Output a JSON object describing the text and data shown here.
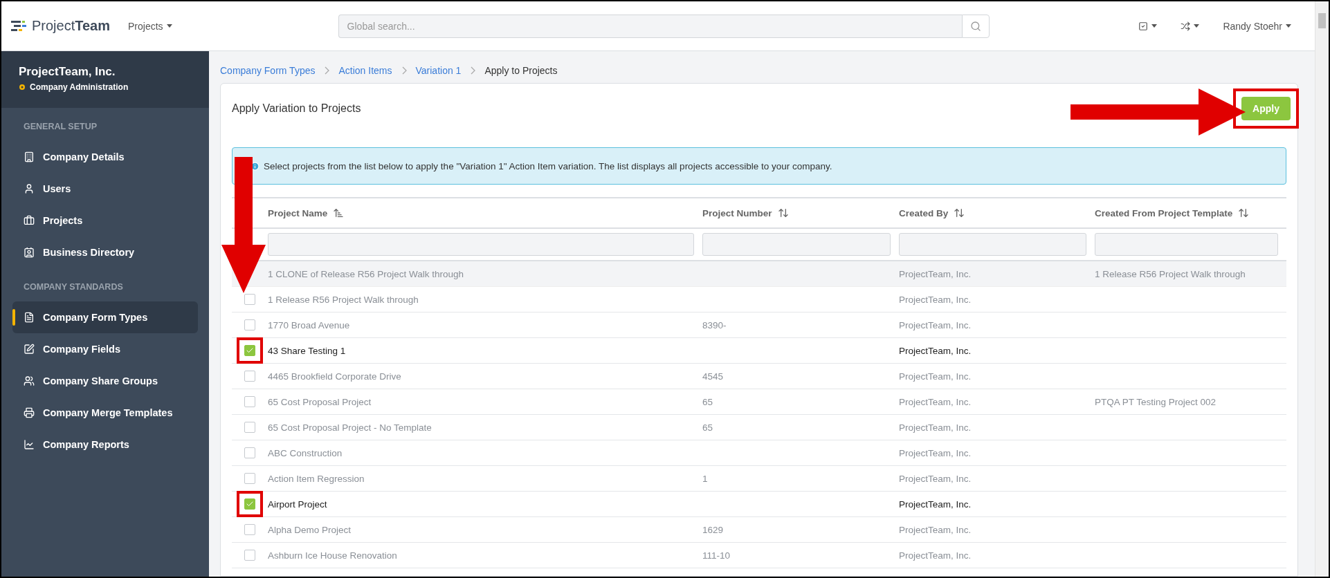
{
  "header": {
    "logo": "Project**Team**",
    "projects_menu": "Projects",
    "search": {
      "placeholder": "Global search..."
    },
    "user_menu": "Randy Stoehr"
  },
  "sidebar": {
    "company": "ProjectTeam, Inc.",
    "subtitle": "Company Administration",
    "sections": [
      {
        "heading": "GENERAL SETUP",
        "items": [
          {
            "label": "Company Details",
            "selected": false
          },
          {
            "label": "Users",
            "selected": false
          },
          {
            "label": "Projects",
            "selected": false
          },
          {
            "label": "Business Directory",
            "selected": false
          }
        ]
      },
      {
        "heading": "COMPANY STANDARDS",
        "items": [
          {
            "label": "Company Form Types",
            "selected": true
          },
          {
            "label": "Company Fields",
            "selected": false
          },
          {
            "label": "Company Share Groups",
            "selected": false
          },
          {
            "label": "Company Merge Templates",
            "selected": false
          },
          {
            "label": "Company Reports",
            "selected": false
          }
        ]
      }
    ]
  },
  "breadcrumb": [
    {
      "label": "Company Form Types",
      "link": true
    },
    {
      "label": "Action Items",
      "link": true
    },
    {
      "label": "Variation 1",
      "link": true
    },
    {
      "label": "Apply to Projects",
      "link": false
    }
  ],
  "panel": {
    "title": "Apply Variation to Projects",
    "apply_button": {
      "label": "Apply",
      "highlighted": true,
      "arrow": true
    },
    "info": "Select projects from the list below to apply the \"Variation 1\" Action Item variation. The list displays all projects accessible to your company."
  },
  "table": {
    "arrow": true,
    "columns": [
      {
        "label": "Project Name",
        "sorted": true
      },
      {
        "label": "Project Number",
        "sorted": false
      },
      {
        "label": "Created By",
        "sorted": false
      },
      {
        "label": "Created From Project Template",
        "sorted": false
      }
    ],
    "rows": [
      {
        "cells": [
          "1 CLONE of Release R56 Project Walk through",
          "",
          "ProjectTeam, Inc.",
          "1 Release R56 Project Walk through"
        ],
        "blurred": true,
        "hovered": true,
        "highlighted": false
      },
      {
        "cells": [
          "1 Release R56 Project Walk through",
          "",
          "ProjectTeam, Inc.",
          ""
        ],
        "checked": false,
        "blurred": true,
        "hovered": false,
        "highlighted": false
      },
      {
        "cells": [
          "1770 Broad Avenue",
          "8390-",
          "ProjectTeam, Inc.",
          ""
        ],
        "checked": false,
        "blurred": true,
        "hovered": false,
        "highlighted": false
      },
      {
        "cells": [
          "43 Share Testing 1",
          "",
          "ProjectTeam, Inc.",
          ""
        ],
        "checked": true,
        "blurred": false,
        "hovered": false,
        "highlighted": true
      },
      {
        "cells": [
          "4465 Brookfield Corporate Drive",
          "4545",
          "ProjectTeam, Inc.",
          ""
        ],
        "checked": false,
        "blurred": true,
        "hovered": false,
        "highlighted": false
      },
      {
        "cells": [
          "65 Cost Proposal Project",
          "65",
          "ProjectTeam, Inc.",
          "PTQA PT Testing Project 002"
        ],
        "checked": false,
        "blurred": true,
        "hovered": false,
        "highlighted": false
      },
      {
        "cells": [
          "65 Cost Proposal Project - No Template",
          "65",
          "ProjectTeam, Inc.",
          ""
        ],
        "checked": false,
        "blurred": true,
        "hovered": false,
        "highlighted": false
      },
      {
        "cells": [
          "ABC Construction",
          "",
          "ProjectTeam, Inc.",
          ""
        ],
        "checked": false,
        "blurred": true,
        "hovered": false,
        "highlighted": false
      },
      {
        "cells": [
          "Action Item Regression",
          "1",
          "ProjectTeam, Inc.",
          ""
        ],
        "checked": false,
        "blurred": true,
        "hovered": false,
        "highlighted": false
      },
      {
        "cells": [
          "Airport Project",
          "",
          "ProjectTeam, Inc.",
          ""
        ],
        "checked": true,
        "blurred": false,
        "hovered": false,
        "highlighted": true
      },
      {
        "cells": [
          "Alpha Demo Project",
          "1629",
          "ProjectTeam, Inc.",
          ""
        ],
        "checked": false,
        "blurred": true,
        "hovered": false,
        "highlighted": false
      },
      {
        "cells": [
          "Ashburn Ice House Renovation",
          "111-10",
          "ProjectTeam, Inc.",
          ""
        ],
        "checked": false,
        "blurred": true,
        "hovered": false,
        "highlighted": false
      }
    ]
  }
}
